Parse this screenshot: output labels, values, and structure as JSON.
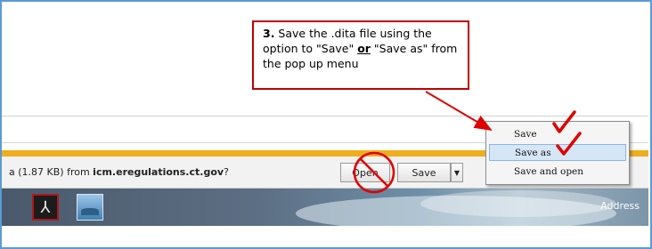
{
  "callout": {
    "number": "3.",
    "part1": " Save the .dita file using the option to \"Save\" ",
    "or": "or",
    "part2": " \"Save as\" from the pop up menu"
  },
  "download_bar": {
    "prefix": "a (1.87 KB) from ",
    "host": "icm.eregulations.ct.gov",
    "suffix": "?",
    "open_label": "Open",
    "save_label": "Save",
    "dropdown_glyph": "▼"
  },
  "popup_menu": {
    "items": [
      {
        "label": "Save"
      },
      {
        "label": "Save as"
      },
      {
        "label": "Save and open"
      }
    ]
  },
  "taskbar": {
    "address_label": "Address",
    "pdf_icon_glyph": "⅄"
  },
  "colors": {
    "annotation_red": "#e00000",
    "frame_border": "#5b9bd5",
    "download_bar_accent": "#f0ad1c",
    "popup_highlight": "#d5e6f7"
  }
}
